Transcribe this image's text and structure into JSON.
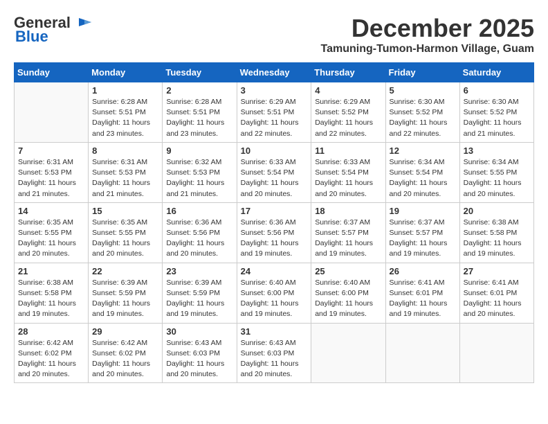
{
  "logo": {
    "general": "General",
    "blue": "Blue"
  },
  "title": {
    "month": "December 2025",
    "location": "Tamuning-Tumon-Harmon Village, Guam"
  },
  "days_of_week": [
    "Sunday",
    "Monday",
    "Tuesday",
    "Wednesday",
    "Thursday",
    "Friday",
    "Saturday"
  ],
  "weeks": [
    [
      {
        "day": "",
        "info": ""
      },
      {
        "day": "1",
        "info": "Sunrise: 6:28 AM\nSunset: 5:51 PM\nDaylight: 11 hours\nand 23 minutes."
      },
      {
        "day": "2",
        "info": "Sunrise: 6:28 AM\nSunset: 5:51 PM\nDaylight: 11 hours\nand 23 minutes."
      },
      {
        "day": "3",
        "info": "Sunrise: 6:29 AM\nSunset: 5:51 PM\nDaylight: 11 hours\nand 22 minutes."
      },
      {
        "day": "4",
        "info": "Sunrise: 6:29 AM\nSunset: 5:52 PM\nDaylight: 11 hours\nand 22 minutes."
      },
      {
        "day": "5",
        "info": "Sunrise: 6:30 AM\nSunset: 5:52 PM\nDaylight: 11 hours\nand 22 minutes."
      },
      {
        "day": "6",
        "info": "Sunrise: 6:30 AM\nSunset: 5:52 PM\nDaylight: 11 hours\nand 21 minutes."
      }
    ],
    [
      {
        "day": "7",
        "info": "Sunrise: 6:31 AM\nSunset: 5:53 PM\nDaylight: 11 hours\nand 21 minutes."
      },
      {
        "day": "8",
        "info": "Sunrise: 6:31 AM\nSunset: 5:53 PM\nDaylight: 11 hours\nand 21 minutes."
      },
      {
        "day": "9",
        "info": "Sunrise: 6:32 AM\nSunset: 5:53 PM\nDaylight: 11 hours\nand 21 minutes."
      },
      {
        "day": "10",
        "info": "Sunrise: 6:33 AM\nSunset: 5:54 PM\nDaylight: 11 hours\nand 20 minutes."
      },
      {
        "day": "11",
        "info": "Sunrise: 6:33 AM\nSunset: 5:54 PM\nDaylight: 11 hours\nand 20 minutes."
      },
      {
        "day": "12",
        "info": "Sunrise: 6:34 AM\nSunset: 5:54 PM\nDaylight: 11 hours\nand 20 minutes."
      },
      {
        "day": "13",
        "info": "Sunrise: 6:34 AM\nSunset: 5:55 PM\nDaylight: 11 hours\nand 20 minutes."
      }
    ],
    [
      {
        "day": "14",
        "info": "Sunrise: 6:35 AM\nSunset: 5:55 PM\nDaylight: 11 hours\nand 20 minutes."
      },
      {
        "day": "15",
        "info": "Sunrise: 6:35 AM\nSunset: 5:55 PM\nDaylight: 11 hours\nand 20 minutes."
      },
      {
        "day": "16",
        "info": "Sunrise: 6:36 AM\nSunset: 5:56 PM\nDaylight: 11 hours\nand 20 minutes."
      },
      {
        "day": "17",
        "info": "Sunrise: 6:36 AM\nSunset: 5:56 PM\nDaylight: 11 hours\nand 19 minutes."
      },
      {
        "day": "18",
        "info": "Sunrise: 6:37 AM\nSunset: 5:57 PM\nDaylight: 11 hours\nand 19 minutes."
      },
      {
        "day": "19",
        "info": "Sunrise: 6:37 AM\nSunset: 5:57 PM\nDaylight: 11 hours\nand 19 minutes."
      },
      {
        "day": "20",
        "info": "Sunrise: 6:38 AM\nSunset: 5:58 PM\nDaylight: 11 hours\nand 19 minutes."
      }
    ],
    [
      {
        "day": "21",
        "info": "Sunrise: 6:38 AM\nSunset: 5:58 PM\nDaylight: 11 hours\nand 19 minutes."
      },
      {
        "day": "22",
        "info": "Sunrise: 6:39 AM\nSunset: 5:59 PM\nDaylight: 11 hours\nand 19 minutes."
      },
      {
        "day": "23",
        "info": "Sunrise: 6:39 AM\nSunset: 5:59 PM\nDaylight: 11 hours\nand 19 minutes."
      },
      {
        "day": "24",
        "info": "Sunrise: 6:40 AM\nSunset: 6:00 PM\nDaylight: 11 hours\nand 19 minutes."
      },
      {
        "day": "25",
        "info": "Sunrise: 6:40 AM\nSunset: 6:00 PM\nDaylight: 11 hours\nand 19 minutes."
      },
      {
        "day": "26",
        "info": "Sunrise: 6:41 AM\nSunset: 6:01 PM\nDaylight: 11 hours\nand 19 minutes."
      },
      {
        "day": "27",
        "info": "Sunrise: 6:41 AM\nSunset: 6:01 PM\nDaylight: 11 hours\nand 20 minutes."
      }
    ],
    [
      {
        "day": "28",
        "info": "Sunrise: 6:42 AM\nSunset: 6:02 PM\nDaylight: 11 hours\nand 20 minutes."
      },
      {
        "day": "29",
        "info": "Sunrise: 6:42 AM\nSunset: 6:02 PM\nDaylight: 11 hours\nand 20 minutes."
      },
      {
        "day": "30",
        "info": "Sunrise: 6:43 AM\nSunset: 6:03 PM\nDaylight: 11 hours\nand 20 minutes."
      },
      {
        "day": "31",
        "info": "Sunrise: 6:43 AM\nSunset: 6:03 PM\nDaylight: 11 hours\nand 20 minutes."
      },
      {
        "day": "",
        "info": ""
      },
      {
        "day": "",
        "info": ""
      },
      {
        "day": "",
        "info": ""
      }
    ]
  ]
}
